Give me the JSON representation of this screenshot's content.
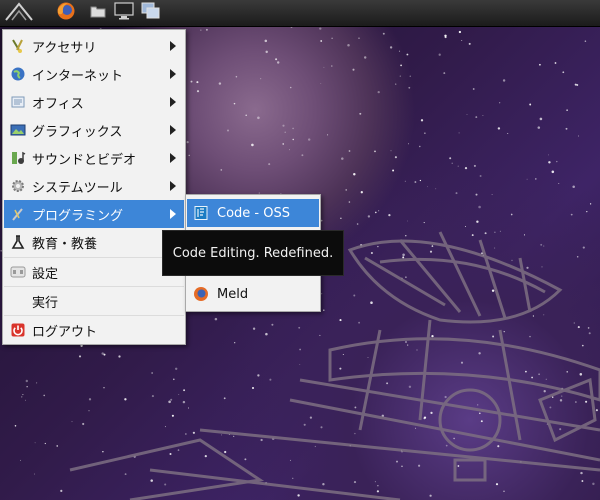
{
  "colors": {
    "menu_bg": "#f2f2f2",
    "highlight": "#3d86d8",
    "panel_bg": "#1b1b1b",
    "tooltip_bg": "#0c0c0c"
  },
  "panel": {
    "launchers": [
      {
        "icon": "lxde-start-icon"
      },
      {
        "icon": "firefox-icon"
      },
      {
        "icon": "file-manager-icon"
      },
      {
        "icon": "terminal-monitor-icon"
      },
      {
        "icon": "window-switcher-icon"
      }
    ]
  },
  "menu": {
    "items": [
      {
        "label": "アクセサリ",
        "icon": "accessories-icon",
        "has_submenu": true
      },
      {
        "label": "インターネット",
        "icon": "internet-globe-icon",
        "has_submenu": true
      },
      {
        "label": "オフィス",
        "icon": "office-icon",
        "has_submenu": true
      },
      {
        "label": "グラフィックス",
        "icon": "graphics-icon",
        "has_submenu": true
      },
      {
        "label": "サウンドとビデオ",
        "icon": "sound-video-icon",
        "has_submenu": true
      },
      {
        "label": "システムツール",
        "icon": "system-tools-icon",
        "has_submenu": true
      },
      {
        "label": "プログラミング",
        "icon": "programming-icon",
        "has_submenu": true,
        "active": true
      },
      {
        "label": "教育・教養",
        "icon": "education-flask-icon",
        "has_submenu": true
      },
      {
        "label": "設定",
        "icon": "settings-icon",
        "has_submenu": false
      },
      {
        "label": "実行",
        "icon": "",
        "has_submenu": false
      },
      {
        "label": "ログアウト",
        "icon": "logout-icon",
        "has_submenu": false
      }
    ]
  },
  "submenu": {
    "items": [
      {
        "label": "Code - OSS",
        "icon": "vscode-icon",
        "active": true
      },
      {
        "label": "Meld",
        "icon": "meld-icon"
      }
    ]
  },
  "tooltip": {
    "text": "Code Editing. Redefined."
  }
}
